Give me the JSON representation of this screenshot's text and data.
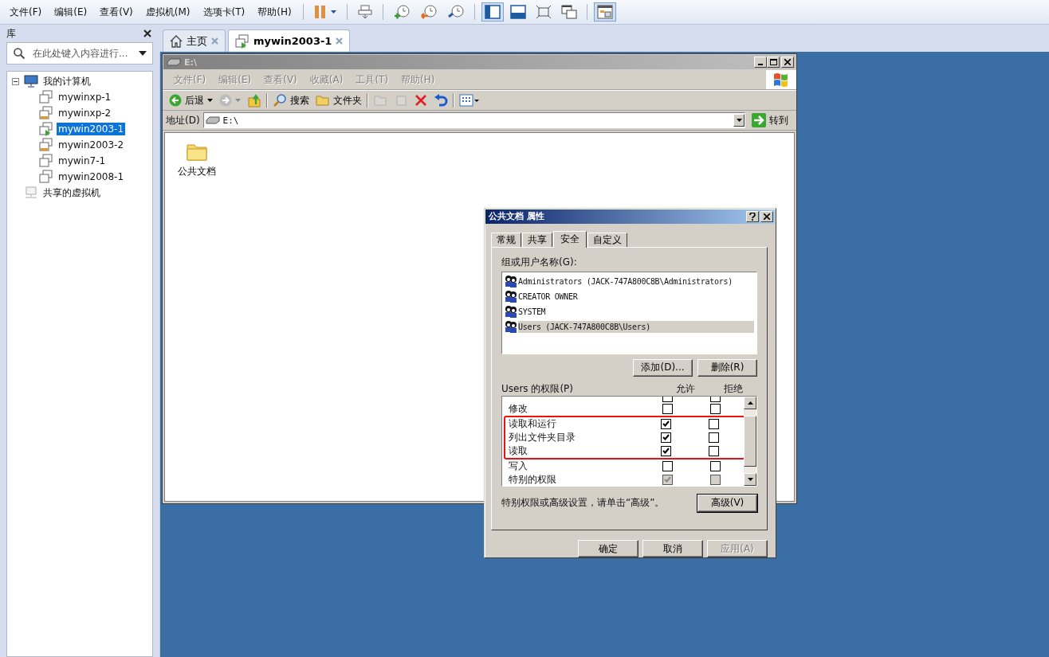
{
  "menubar": {
    "items": [
      "文件(F)",
      "编辑(E)",
      "查看(V)",
      "虚拟机(M)",
      "选项卡(T)",
      "帮助(H)"
    ]
  },
  "toolbar": [
    {
      "kind": "pause",
      "pressed": false
    },
    {
      "kind": "send-keys",
      "pressed": false
    },
    {
      "kind": "snapshot",
      "pressed": false
    },
    {
      "kind": "revert",
      "pressed": false
    },
    {
      "kind": "manager",
      "pressed": false
    },
    {
      "kind": "sidebar",
      "pressed": true
    },
    {
      "kind": "thumbnail",
      "pressed": false
    },
    {
      "kind": "fullscreen",
      "pressed": false
    },
    {
      "kind": "unity",
      "pressed": false
    },
    {
      "kind": "console",
      "pressed": true
    }
  ],
  "library": {
    "title": "库",
    "search": {
      "placeholder": "在此处键入内容进行..."
    },
    "tree": [
      {
        "label": "我的计算机",
        "kind": "computer",
        "expanded": true,
        "children": [
          {
            "label": "mywinxp-1",
            "running": false,
            "suspended": false,
            "selected": false
          },
          {
            "label": "mywinxp-2",
            "running": false,
            "suspended": true,
            "selected": false
          },
          {
            "label": "mywin2003-1",
            "running": true,
            "suspended": false,
            "selected": true
          },
          {
            "label": "mywin2003-2",
            "running": false,
            "suspended": true,
            "selected": false
          },
          {
            "label": "mywin7-1",
            "running": false,
            "suspended": false,
            "selected": false
          },
          {
            "label": "mywin2008-1",
            "running": false,
            "suspended": false,
            "selected": false
          }
        ]
      },
      {
        "label": "共享的虚拟机",
        "kind": "shared"
      }
    ]
  },
  "tabs": [
    {
      "label": "主页",
      "kind": "home",
      "selected": false
    },
    {
      "label": "mywin2003-1",
      "kind": "vm",
      "selected": true
    }
  ],
  "explorer": {
    "title": "E:\\",
    "menu": [
      "文件(F)",
      "编辑(E)",
      "查看(V)",
      "收藏(A)",
      "工具(T)",
      "帮助(H)"
    ],
    "toolbar": {
      "back": "后退",
      "search": "搜索",
      "folders": "文件夹"
    },
    "address": {
      "label": "地址(D)",
      "value": "E:\\",
      "go": "转到"
    },
    "items": [
      {
        "name": "公共文档"
      }
    ]
  },
  "dialog": {
    "title": "公共文档 属性",
    "tabs": [
      {
        "label": "常规",
        "selected": false
      },
      {
        "label": "共享",
        "selected": false
      },
      {
        "label": "安全",
        "selected": true
      },
      {
        "label": "自定义",
        "selected": false
      }
    ],
    "group_label": "组或用户名称(G):",
    "users": [
      {
        "name": "Administrators (JACK-747A800C8B\\Administrators)",
        "selected": false
      },
      {
        "name": "CREATOR OWNER",
        "selected": false
      },
      {
        "name": "SYSTEM",
        "selected": false
      },
      {
        "name": "Users (JACK-747A800C8B\\Users)",
        "selected": true
      }
    ],
    "add_button": "添加(D)...",
    "remove_button": "删除(R)",
    "permissions_label": "Users 的权限(P)",
    "allow_header": "允许",
    "deny_header": "拒绝",
    "permissions": [
      {
        "kind": "partial",
        "allow": false,
        "deny": false,
        "disabled": false,
        "highlighted": false
      },
      {
        "kind": "full",
        "label": "修改",
        "allow": false,
        "deny": false,
        "disabled": false,
        "highlighted": false
      },
      {
        "kind": "full",
        "label": "读取和运行",
        "allow": true,
        "deny": false,
        "disabled": false,
        "highlighted": true
      },
      {
        "kind": "full",
        "label": "列出文件夹目录",
        "allow": true,
        "deny": false,
        "disabled": false,
        "highlighted": true
      },
      {
        "kind": "full",
        "label": "读取",
        "allow": true,
        "deny": false,
        "disabled": false,
        "highlighted": true
      },
      {
        "kind": "full",
        "label": "写入",
        "allow": false,
        "deny": false,
        "disabled": false,
        "highlighted": false
      },
      {
        "kind": "full",
        "label": "特别的权限",
        "allow": true,
        "deny": false,
        "disabled": true,
        "highlighted": false
      }
    ],
    "note": "特别权限或高级设置，请单击“高级”。",
    "advanced_button": "高级(V)",
    "buttons": [
      {
        "label": "确定",
        "disabled": false
      },
      {
        "label": "取消",
        "disabled": false
      },
      {
        "label": "应用(A)",
        "disabled": true
      }
    ]
  }
}
